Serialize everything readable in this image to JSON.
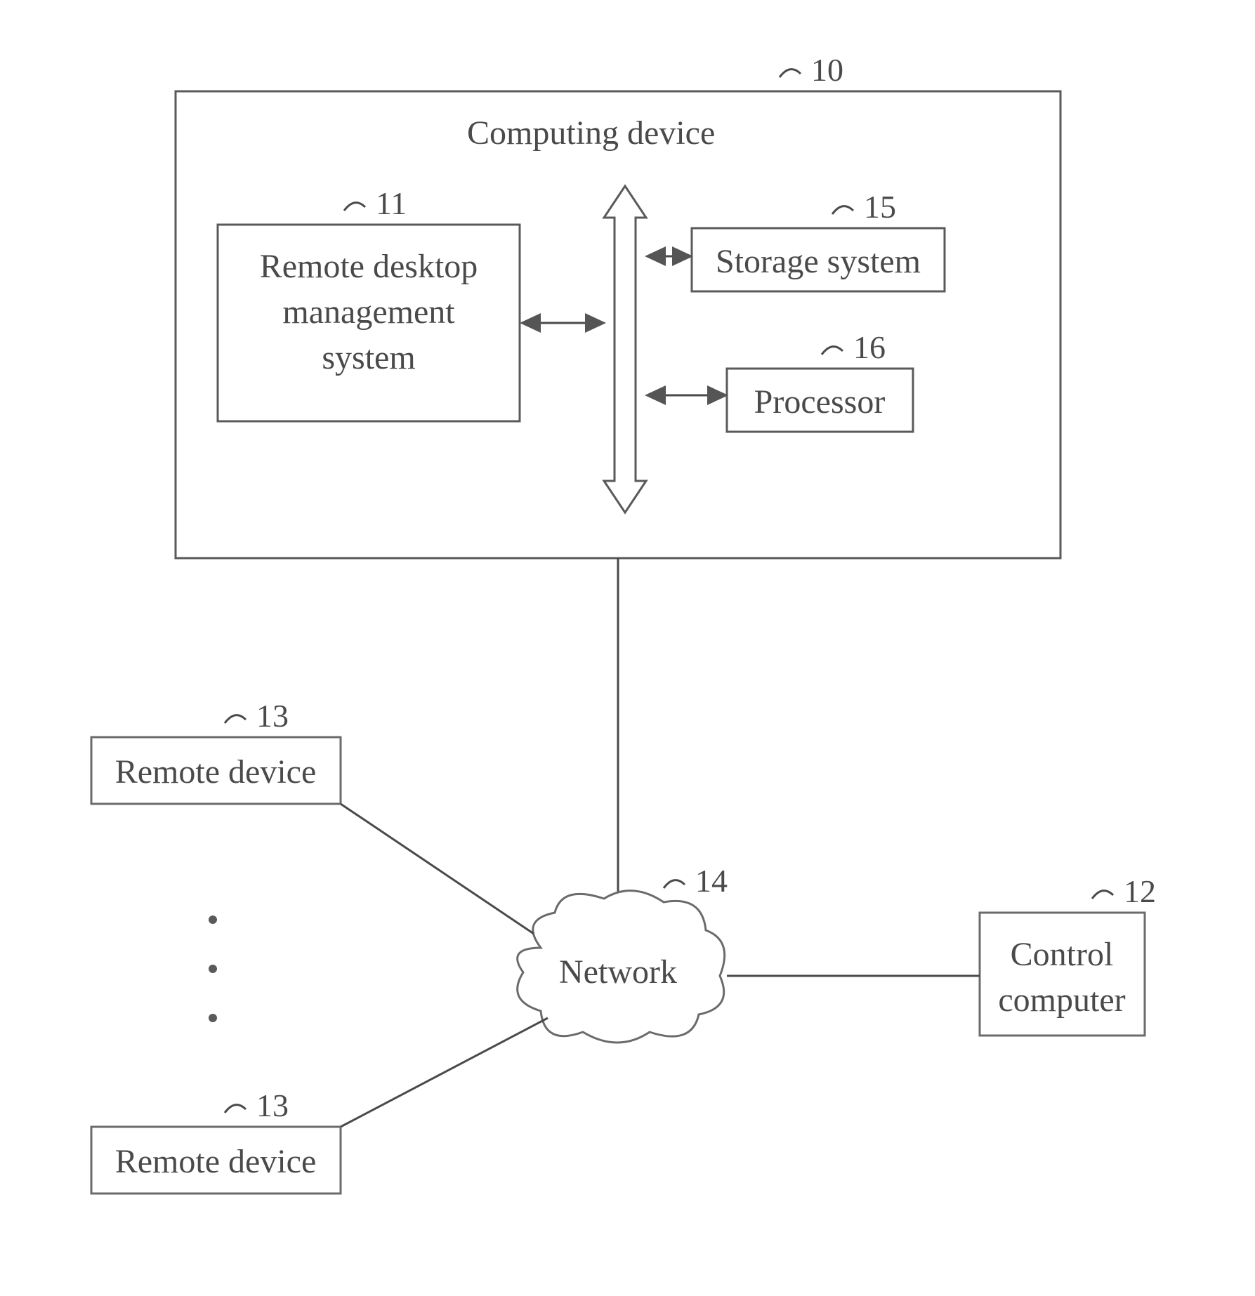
{
  "diagram": {
    "computing_device": {
      "title": "Computing device",
      "ref": "10",
      "remote_desktop_mgmt": {
        "line1": "Remote desktop",
        "line2": "management",
        "line3": "system",
        "ref": "11"
      },
      "storage_system": {
        "label": "Storage system",
        "ref": "15"
      },
      "processor": {
        "label": "Processor",
        "ref": "16"
      }
    },
    "remote_device_top": {
      "label": "Remote device",
      "ref": "13"
    },
    "remote_device_bottom": {
      "label": "Remote device",
      "ref": "13"
    },
    "network": {
      "label": "Network",
      "ref": "14"
    },
    "control_computer": {
      "line1": "Control",
      "line2": "computer",
      "ref": "12"
    }
  }
}
